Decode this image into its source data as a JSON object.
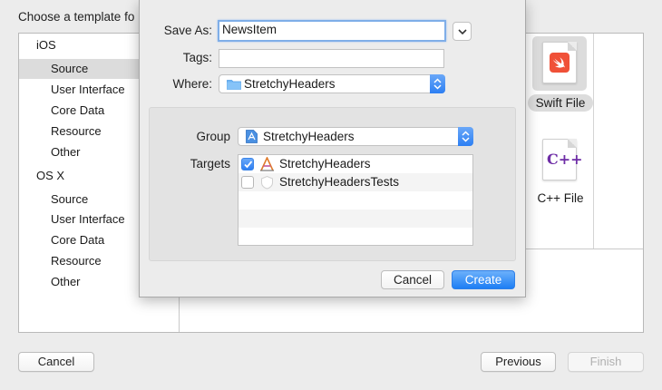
{
  "chooser": {
    "title": "Choose a template fo",
    "categories": [
      {
        "label": "iOS",
        "kind": "platform"
      },
      {
        "label": "Source",
        "kind": "sub",
        "selected": true
      },
      {
        "label": "User Interface",
        "kind": "sub"
      },
      {
        "label": "Core Data",
        "kind": "sub"
      },
      {
        "label": "Resource",
        "kind": "sub"
      },
      {
        "label": "Other",
        "kind": "sub"
      },
      {
        "label": "OS X",
        "kind": "platform"
      },
      {
        "label": "Source",
        "kind": "sub"
      },
      {
        "label": "User Interface",
        "kind": "sub"
      },
      {
        "label": "Core Data",
        "kind": "sub"
      },
      {
        "label": "Resource",
        "kind": "sub"
      },
      {
        "label": "Other",
        "kind": "sub"
      }
    ],
    "templates": {
      "swift": {
        "label": "Swift File",
        "icon": "swift-file-icon",
        "selected": true
      },
      "cpp": {
        "label": "C++ File",
        "icon": "cpp-file-icon",
        "glyph": "C++"
      }
    },
    "buttons": {
      "cancel": "Cancel",
      "previous": "Previous",
      "finish": "Finish"
    }
  },
  "save_sheet": {
    "save_as_label": "Save As:",
    "save_as_value": "NewsItem",
    "tags_label": "Tags:",
    "tags_value": "",
    "where_label": "Where:",
    "where_value": "StretchyHeaders",
    "group_label": "Group",
    "group_value": "StretchyHeaders",
    "targets_label": "Targets",
    "targets": [
      {
        "name": "StretchyHeaders",
        "checked": true,
        "icon": "app-target-icon"
      },
      {
        "name": "StretchyHeadersTests",
        "checked": false,
        "icon": "test-target-icon"
      }
    ],
    "cancel_label": "Cancel",
    "create_label": "Create"
  },
  "colors": {
    "accent": "#2d7ff3",
    "swift": "#f05138",
    "cpp": "#6e2da6",
    "focus_ring": "#7faee8"
  }
}
